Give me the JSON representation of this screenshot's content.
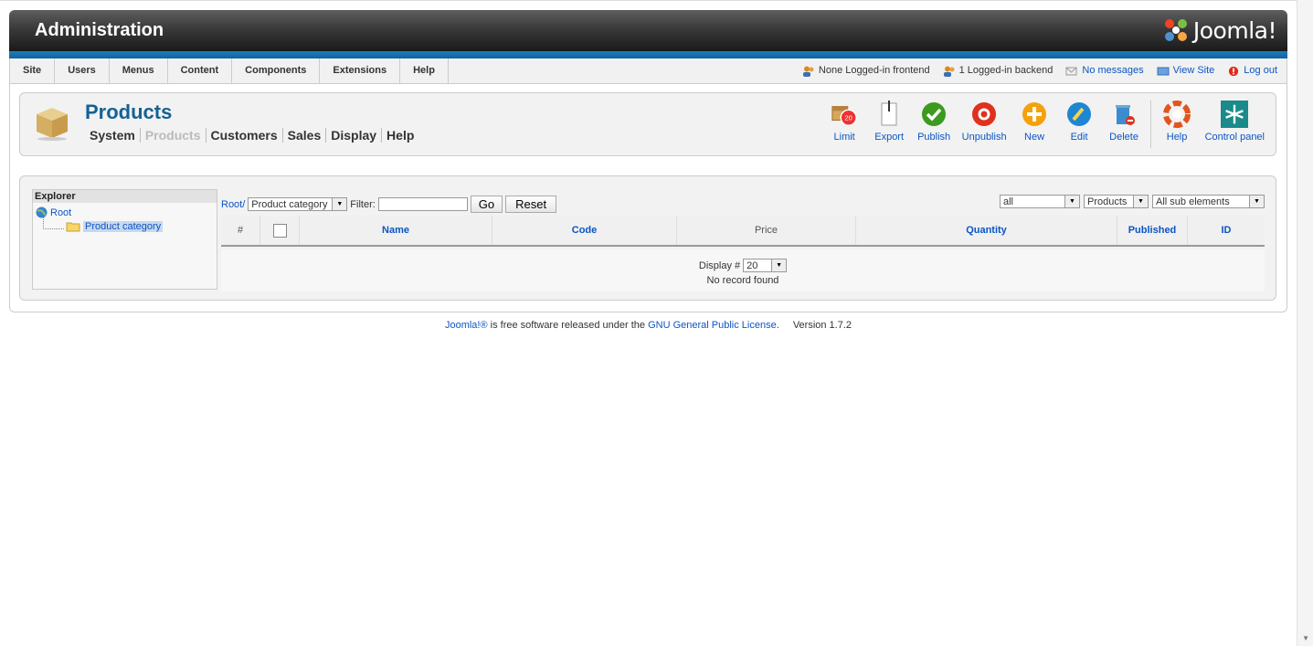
{
  "header": {
    "title": "Administration",
    "logo_text": "Joomla!"
  },
  "menu": {
    "items": [
      "Site",
      "Users",
      "Menus",
      "Content",
      "Components",
      "Extensions",
      "Help"
    ]
  },
  "status": {
    "frontend": "None Logged-in frontend",
    "backend": "1 Logged-in backend",
    "messages": "No messages",
    "view_site": "View Site",
    "logout": "Log out"
  },
  "page": {
    "title": "Products",
    "subnav": [
      "System",
      "Products",
      "Customers",
      "Sales",
      "Display",
      "Help"
    ],
    "active_subnav": "Products"
  },
  "toolbar": {
    "buttons": [
      {
        "label": "Limit",
        "icon": "limit-icon"
      },
      {
        "label": "Export",
        "icon": "export-icon"
      },
      {
        "label": "Publish",
        "icon": "publish-icon"
      },
      {
        "label": "Unpublish",
        "icon": "unpublish-icon"
      },
      {
        "label": "New",
        "icon": "new-icon"
      },
      {
        "label": "Edit",
        "icon": "edit-icon"
      },
      {
        "label": "Delete",
        "icon": "delete-icon"
      },
      {
        "label": "Help",
        "icon": "help-icon"
      },
      {
        "label": "Control panel",
        "icon": "control-panel-icon"
      }
    ],
    "limit_badge": "20"
  },
  "explorer": {
    "title": "Explorer",
    "root": "Root",
    "child": "Product category"
  },
  "filters": {
    "breadcrumb": "Root/",
    "category_select": "Product category",
    "filter_label": "Filter:",
    "filter_value": "",
    "go_label": "Go",
    "reset_label": "Reset",
    "scope_select": "all",
    "type_select": "Products",
    "sub_select": "All sub elements"
  },
  "table": {
    "columns": [
      "#",
      "",
      "Name",
      "Code",
      "Price",
      "Quantity",
      "Published",
      "ID"
    ],
    "display_label": "Display #",
    "display_value": "20",
    "empty_text": "No record found"
  },
  "footer": {
    "joomla_link": "Joomla!®",
    "text1": " is free software released under the ",
    "license_link": "GNU General Public License",
    "text2": ".",
    "version": "Version 1.7.2"
  },
  "colors": {
    "brand_blue": "#146295",
    "link": "#0b55c4",
    "header_dark": "#1a1a1a"
  }
}
